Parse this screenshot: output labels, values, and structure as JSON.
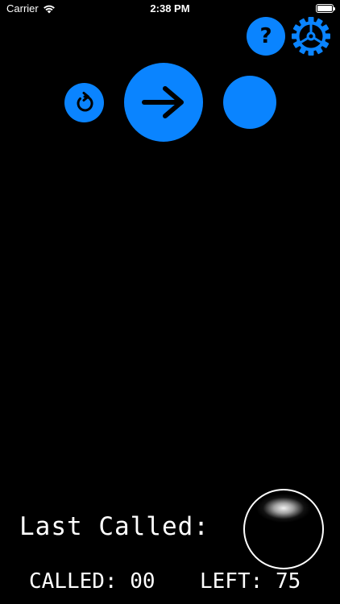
{
  "status_bar": {
    "carrier": "Carrier",
    "time": "2:38 PM",
    "wifi_icon": "wifi-icon",
    "battery_level": 1.0
  },
  "toolbar": {
    "help_label": "?",
    "help_icon": "question-mark-icon",
    "settings_icon": "gear-icon"
  },
  "controls": {
    "reset_icon": "rotate-counterclockwise-icon",
    "next_icon": "arrow-right-icon",
    "auto_icon": "blank-circle"
  },
  "colors": {
    "accent": "#0a84ff",
    "background": "#000000",
    "text": "#ffffff"
  },
  "bottom": {
    "last_called_label": "Last Called:",
    "called_label": "CALLED:",
    "called_count": "00",
    "left_label": "LEFT:",
    "left_count": "75"
  }
}
